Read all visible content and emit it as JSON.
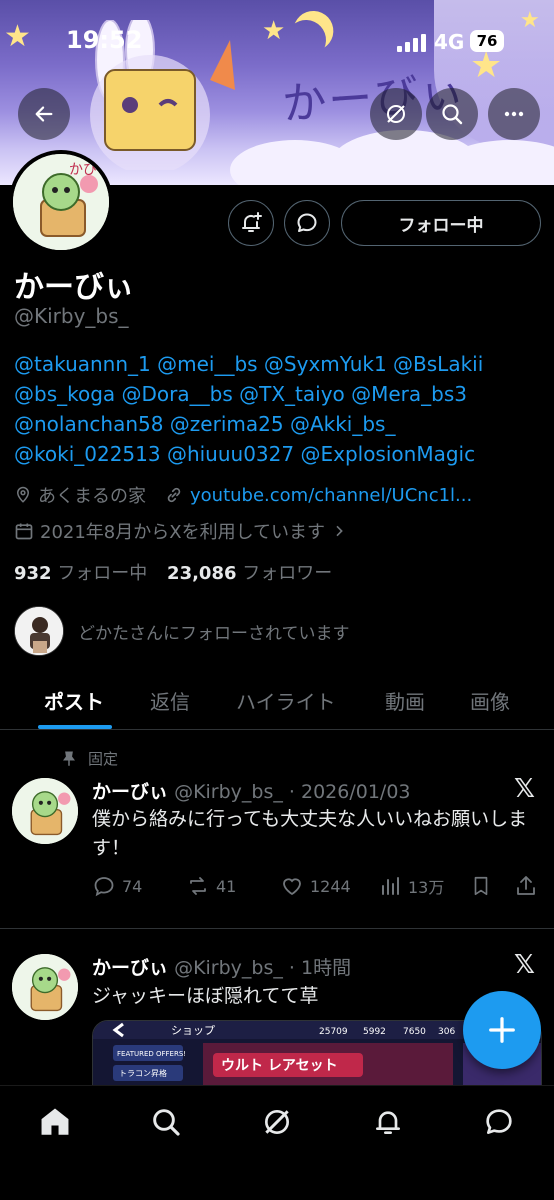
{
  "status_bar": {
    "time": "19:52",
    "carrier": "4G",
    "battery": "76"
  },
  "banner": {
    "title": "かーびぃ"
  },
  "profile": {
    "name": "かーびぃ",
    "handle": "@Kirby_bs_",
    "following_button": "フォロー中",
    "bio_lines": [
      "@takuannn_1 @mei__bs @SyxmYuk1 @BsLakii",
      "@bs_koga @Dora__bs @TX_taiyo @Mera_bs3",
      "@nolanchan58 @zerima25 @Akki_bs_",
      "@koki_022513 @hiuuu0327 @ExplosionMagic"
    ],
    "location": "あくまるの家",
    "link": "youtube.com/channel/UCnc1l...",
    "joined": "2021年8月からXを利用しています",
    "following_count": "932",
    "following_label": "フォロー中",
    "followers_count": "23,086",
    "followers_label": "フォロワー",
    "followed_by": "どかたさんにフォローされています"
  },
  "tabs": [
    "ポスト",
    "返信",
    "ハイライト",
    "動画",
    "画像"
  ],
  "pinned_label": "固定",
  "posts": [
    {
      "name": "かーびぃ",
      "handle_time": "@Kirby_bs_ · 2026/01/03",
      "text": "僕から絡みに行っても大丈夫な人いいねお願いします！",
      "replies": "74",
      "reposts": "41",
      "likes": "1244",
      "views": "13万"
    },
    {
      "name": "かーびぃ",
      "handle_time": "@Kirby_bs_ · 1時間",
      "text": "ジャッキーほぼ隠れてて草",
      "media_labels": {
        "shop": "ショップ",
        "featured": "FEATURED OFFERS!",
        "tab2": "トラコン昇格",
        "stat1": "25709",
        "stat2": "5992",
        "stat3": "7650",
        "stat4": "306",
        "offer": "ウルト  レアセット"
      }
    }
  ],
  "icons": {
    "back": "back-arrow-icon",
    "grok": "grok-icon",
    "search": "search-icon",
    "more": "more-icon",
    "notify": "bell-plus-icon",
    "message": "message-icon",
    "home": "home-icon",
    "compose": "plus-icon"
  },
  "colors": {
    "accent": "#1d9bf0",
    "muted": "#71767b",
    "background": "#000000"
  }
}
